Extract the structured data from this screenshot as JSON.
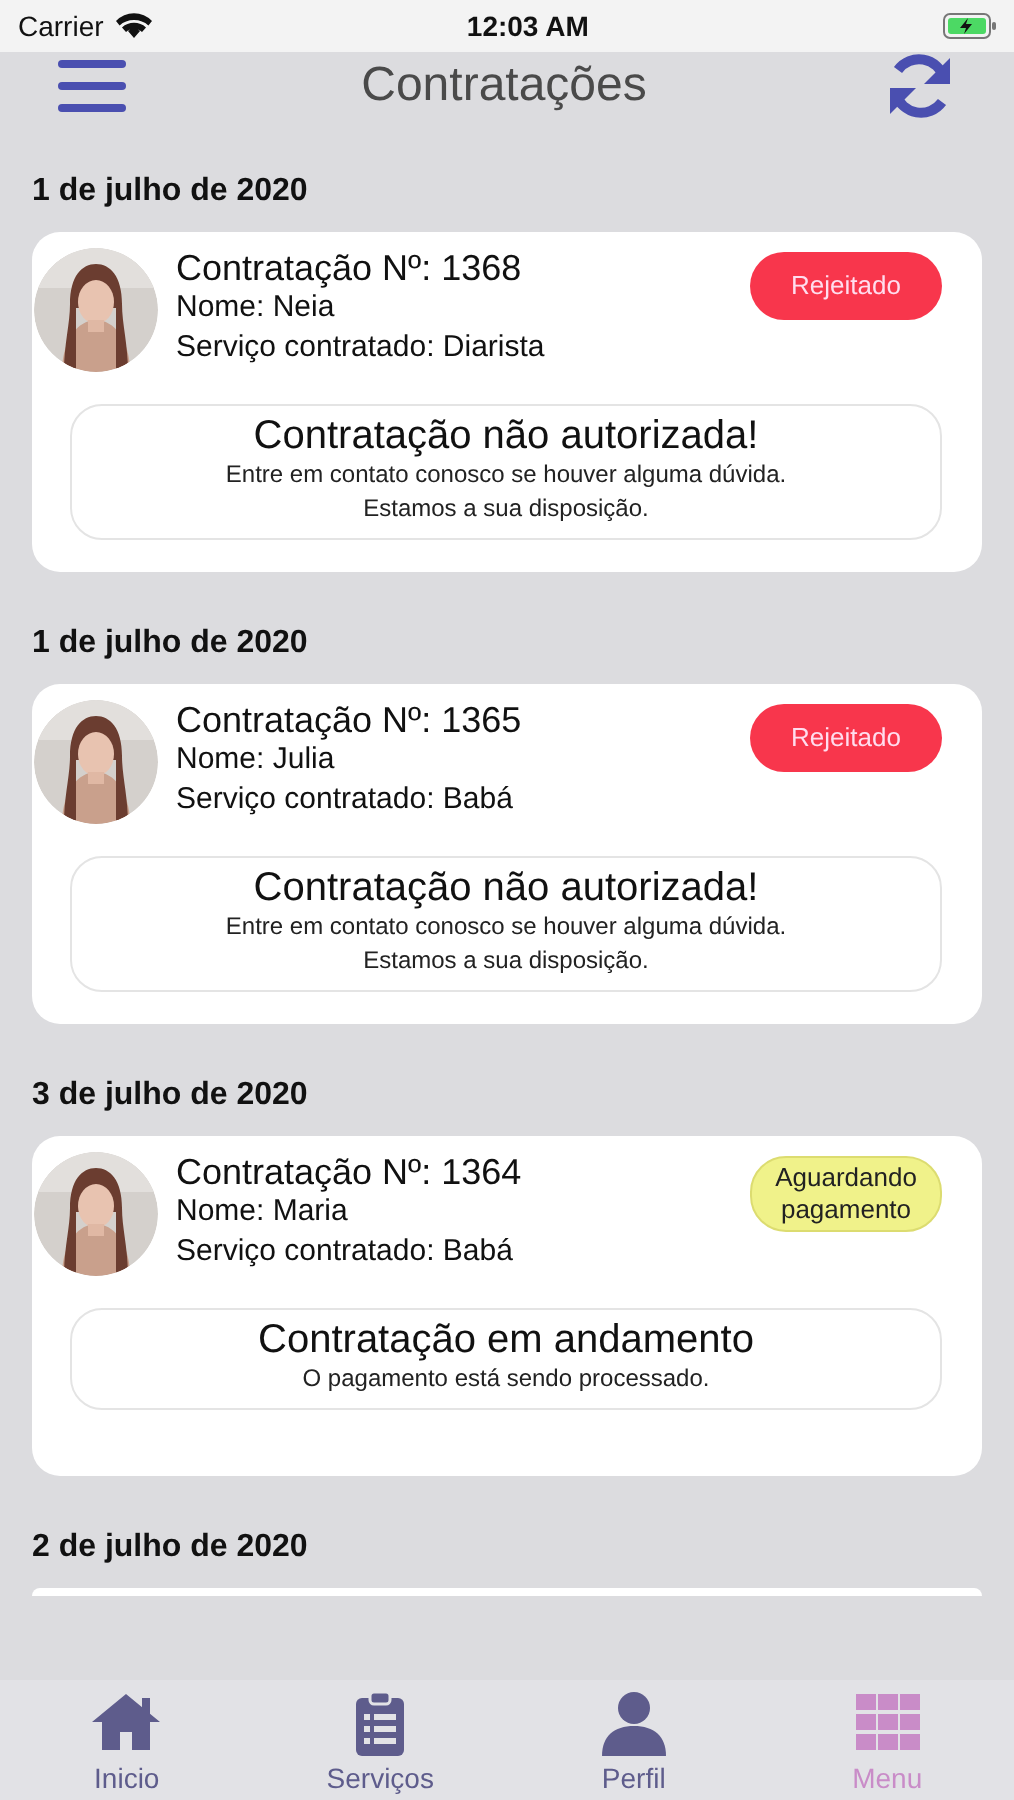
{
  "status_bar": {
    "carrier": "Carrier",
    "time": "12:03 AM"
  },
  "header": {
    "title": "Contratações"
  },
  "sections": [
    {
      "kind": "full",
      "date": "1 de julho de 2020",
      "contract": {
        "number": "Contratação Nº: 1368",
        "name": "Nome: Neia",
        "service": "Serviço contratado: Diarista",
        "status": {
          "kind": "rejected",
          "label": "Rejeitado"
        },
        "message": {
          "title": "Contratação não autorizada!",
          "lines": [
            "Entre em contato conosco se houver alguma dúvida.",
            "Estamos a sua disposição."
          ]
        }
      }
    },
    {
      "kind": "full",
      "date": "1 de julho de 2020",
      "contract": {
        "number": "Contratação Nº: 1365",
        "name": "Nome: Julia",
        "service": "Serviço contratado: Babá",
        "status": {
          "kind": "rejected",
          "label": "Rejeitado"
        },
        "message": {
          "title": "Contratação não autorizada!",
          "lines": [
            "Entre em contato conosco se houver alguma dúvida.",
            "Estamos a sua disposição."
          ]
        }
      }
    },
    {
      "kind": "full",
      "date": "3 de julho de 2020",
      "contract": {
        "number": "Contratação Nº: 1364",
        "name": "Nome: Maria",
        "service": "Serviço contratado: Babá",
        "status": {
          "kind": "pending",
          "label": "Aguardando pagamento"
        },
        "message": {
          "title": "Contratação em andamento",
          "lines": [
            "O pagamento está sendo processado."
          ]
        }
      }
    },
    {
      "kind": "cut",
      "date": "2 de julho de 2020"
    }
  ],
  "tab_bar": [
    {
      "kind": "home",
      "label": "Inicio",
      "selected": false
    },
    {
      "kind": "services",
      "label": "Serviços",
      "selected": false
    },
    {
      "kind": "profile",
      "label": "Perfil",
      "selected": false
    },
    {
      "kind": "menu",
      "label": "Menu",
      "selected": true
    }
  ]
}
